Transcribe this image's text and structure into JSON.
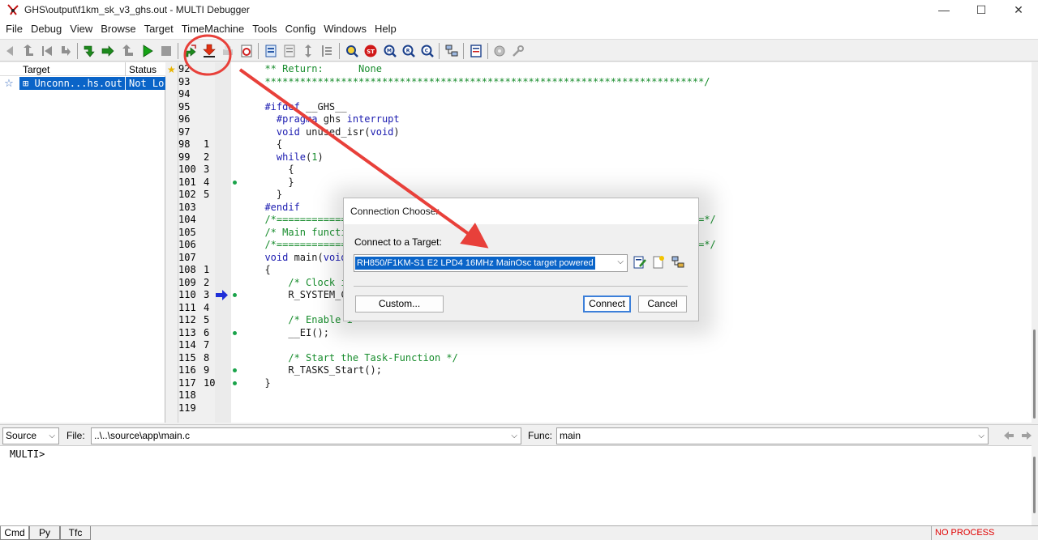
{
  "window": {
    "title": "GHS\\output\\f1km_sk_v3_ghs.out - MULTI Debugger",
    "min_glyph": "—",
    "max_glyph": "☐",
    "close_glyph": "✕"
  },
  "menu": [
    "File",
    "Debug",
    "View",
    "Browse",
    "Target",
    "TimeMachine",
    "Tools",
    "Config",
    "Windows",
    "Help"
  ],
  "toolbar_icons": [
    "back-icon",
    "up-icon",
    "step-back-icon",
    "return-icon",
    "step-into-icon",
    "step-over-icon",
    "step-out-icon",
    "run-icon",
    "stop-icon",
    "connect-icon",
    "download-icon",
    "print-icon",
    "restart-icon",
    "browse-icon",
    "source-icon",
    "mixed-icon",
    "assembly-icon",
    "find-icon",
    "stop-sign-icon",
    "memory-icon",
    "registers-icon",
    "callstack-icon",
    "locals-icon",
    "target-list-icon",
    "notes-icon",
    "gear-icon",
    "wrench-icon"
  ],
  "targets": {
    "col_target": "Target",
    "col_status": "Status",
    "row_target": "⊞ Unconn...hs.out",
    "row_status": "Not Lo"
  },
  "code": {
    "lines": [
      {
        "ln": "92",
        "cnt": "",
        "dot": false,
        "parts": [
          {
            "t": "  ** Return:      None",
            "c": "c-green"
          }
        ]
      },
      {
        "ln": "93",
        "cnt": "",
        "dot": false,
        "parts": [
          {
            "t": "  ***************************************************************************/",
            "c": "c-green"
          }
        ]
      },
      {
        "ln": "94",
        "cnt": "",
        "dot": false,
        "parts": [
          {
            "t": "",
            "c": "c-default"
          }
        ]
      },
      {
        "ln": "95",
        "cnt": "",
        "dot": false,
        "parts": [
          {
            "t": "  #ifdef",
            "c": "c-blue"
          },
          {
            "t": " __GHS__",
            "c": "c-default"
          }
        ]
      },
      {
        "ln": "96",
        "cnt": "",
        "dot": false,
        "parts": [
          {
            "t": "    #pragma",
            "c": "c-blue"
          },
          {
            "t": " ghs ",
            "c": "c-default"
          },
          {
            "t": "interrupt",
            "c": "c-blue"
          }
        ]
      },
      {
        "ln": "97",
        "cnt": "",
        "dot": false,
        "parts": [
          {
            "t": "    void",
            "c": "c-blue"
          },
          {
            "t": " unused_isr(",
            "c": "c-default"
          },
          {
            "t": "void",
            "c": "c-blue"
          },
          {
            "t": ")",
            "c": "c-default"
          }
        ]
      },
      {
        "ln": "98",
        "cnt": "1",
        "dot": false,
        "parts": [
          {
            "t": "    {",
            "c": "c-default"
          }
        ]
      },
      {
        "ln": "99",
        "cnt": "2",
        "dot": false,
        "parts": [
          {
            "t": "    while",
            "c": "c-blue"
          },
          {
            "t": "(",
            "c": "c-default"
          },
          {
            "t": "1",
            "c": "c-green"
          },
          {
            "t": ")",
            "c": "c-default"
          }
        ]
      },
      {
        "ln": "100",
        "cnt": "3",
        "dot": false,
        "parts": [
          {
            "t": "      {",
            "c": "c-default"
          }
        ]
      },
      {
        "ln": "101",
        "cnt": "4",
        "dot": true,
        "parts": [
          {
            "t": "      }",
            "c": "c-default"
          }
        ]
      },
      {
        "ln": "102",
        "cnt": "5",
        "dot": false,
        "parts": [
          {
            "t": "    }",
            "c": "c-default"
          }
        ]
      },
      {
        "ln": "103",
        "cnt": "",
        "dot": false,
        "parts": [
          {
            "t": "  #endif",
            "c": "c-blue"
          }
        ]
      },
      {
        "ln": "104",
        "cnt": "",
        "dot": false,
        "parts": [
          {
            "t": "  /*===============",
            "c": "c-green"
          },
          {
            "t": "                                                         ",
            "c": "c-default"
          },
          {
            "t": "=*/",
            "c": "c-green"
          }
        ]
      },
      {
        "ln": "105",
        "cnt": "",
        "dot": false,
        "parts": [
          {
            "t": "  /* Main function",
            "c": "c-green"
          }
        ]
      },
      {
        "ln": "106",
        "cnt": "",
        "dot": false,
        "parts": [
          {
            "t": "  /*===============",
            "c": "c-green"
          },
          {
            "t": "                                                         ",
            "c": "c-default"
          },
          {
            "t": "=*/",
            "c": "c-green"
          }
        ]
      },
      {
        "ln": "107",
        "cnt": "",
        "dot": false,
        "parts": [
          {
            "t": "  void",
            "c": "c-blue"
          },
          {
            "t": " main(",
            "c": "c-default"
          },
          {
            "t": "void",
            "c": "c-blue"
          },
          {
            "t": ")",
            "c": "c-default"
          }
        ]
      },
      {
        "ln": "108",
        "cnt": "1",
        "dot": false,
        "parts": [
          {
            "t": "  {",
            "c": "c-default"
          }
        ]
      },
      {
        "ln": "109",
        "cnt": "2",
        "dot": false,
        "parts": [
          {
            "t": "      /* Clock in",
            "c": "c-green"
          }
        ]
      },
      {
        "ln": "110",
        "cnt": "3",
        "dot": true,
        "pc": true,
        "parts": [
          {
            "t": "      R_SYSTEM_Cl",
            "c": "c-default"
          }
        ]
      },
      {
        "ln": "111",
        "cnt": "4",
        "dot": false,
        "parts": [
          {
            "t": "",
            "c": "c-default"
          }
        ]
      },
      {
        "ln": "112",
        "cnt": "5",
        "dot": false,
        "parts": [
          {
            "t": "      /* Enable i",
            "c": "c-green"
          }
        ]
      },
      {
        "ln": "113",
        "cnt": "6",
        "dot": true,
        "parts": [
          {
            "t": "      __EI();",
            "c": "c-default"
          }
        ]
      },
      {
        "ln": "114",
        "cnt": "7",
        "dot": false,
        "parts": [
          {
            "t": "",
            "c": "c-default"
          }
        ]
      },
      {
        "ln": "115",
        "cnt": "8",
        "dot": false,
        "parts": [
          {
            "t": "      /* Start the Task-Function */",
            "c": "c-green"
          }
        ]
      },
      {
        "ln": "116",
        "cnt": "9",
        "dot": true,
        "parts": [
          {
            "t": "      R_TASKS_Start();",
            "c": "c-default"
          }
        ]
      },
      {
        "ln": "117",
        "cnt": "10",
        "dot": true,
        "parts": [
          {
            "t": "  }",
            "c": "c-default"
          }
        ]
      },
      {
        "ln": "118",
        "cnt": "",
        "dot": false,
        "parts": [
          {
            "t": "",
            "c": "c-default"
          }
        ]
      },
      {
        "ln": "119",
        "cnt": "",
        "dot": false,
        "parts": [
          {
            "t": "",
            "c": "c-default"
          }
        ]
      }
    ]
  },
  "filebar": {
    "view_mode": "Source",
    "file_label": "File:",
    "file_value": "..\\..\\source\\app\\main.c",
    "func_label": "Func:",
    "func_value": "main"
  },
  "cmd": {
    "prompt": "MULTI>"
  },
  "tabs": [
    "Cmd",
    "Py",
    "Tfc"
  ],
  "status": "NO PROCESS",
  "dialog": {
    "title": "Connection Chooser",
    "label": "Connect to a Target:",
    "selected_target": "RH850/F1KM-S1  E2 LPD4  16MHz MainOsc  target powered",
    "custom_button": "Custom...",
    "connect_button": "Connect",
    "cancel_button": "Cancel"
  },
  "colors": {
    "selection": "#0a64c8",
    "annotation": "#e8403a",
    "status_error": "#e00000"
  }
}
